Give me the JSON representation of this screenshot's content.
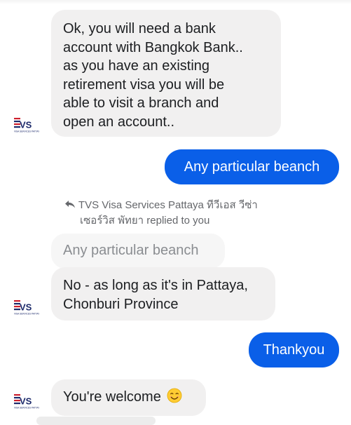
{
  "chat": {
    "avatar_logo": "TVS",
    "avatar_subtext": "VISA SERVICES PATTAYA",
    "messages": {
      "m1": {
        "lines": [
          "Ok, you will need a bank",
          "account with Bangkok Bank..",
          "as you have an existing",
          "retirement visa you will be",
          "able to visit a branch and",
          "open an account.."
        ]
      },
      "m2": {
        "text": "Any particular beanch"
      },
      "reply_note": {
        "line1": "TVS Visa Services Pattaya ทีวีเอส วีซ่า",
        "line2": "เซอร์วิส พัทยา replied to you"
      },
      "quoted": {
        "text": "Any particular beanch"
      },
      "m3": {
        "lines": [
          "No - as long as it's in Pattaya,",
          "Chonburi Province"
        ]
      },
      "m4": {
        "text": "Thankyou"
      },
      "m5": {
        "text": "You're welcome",
        "emoji": "smiling-face-emoji"
      }
    }
  },
  "colors": {
    "incoming_bubble": "#f1f0f0",
    "outgoing_bubble": "#0a5fe8",
    "quoted_bubble": "#f6f6f6",
    "logo_red": "#cc1f2e",
    "logo_navy": "#1d2a6b"
  }
}
